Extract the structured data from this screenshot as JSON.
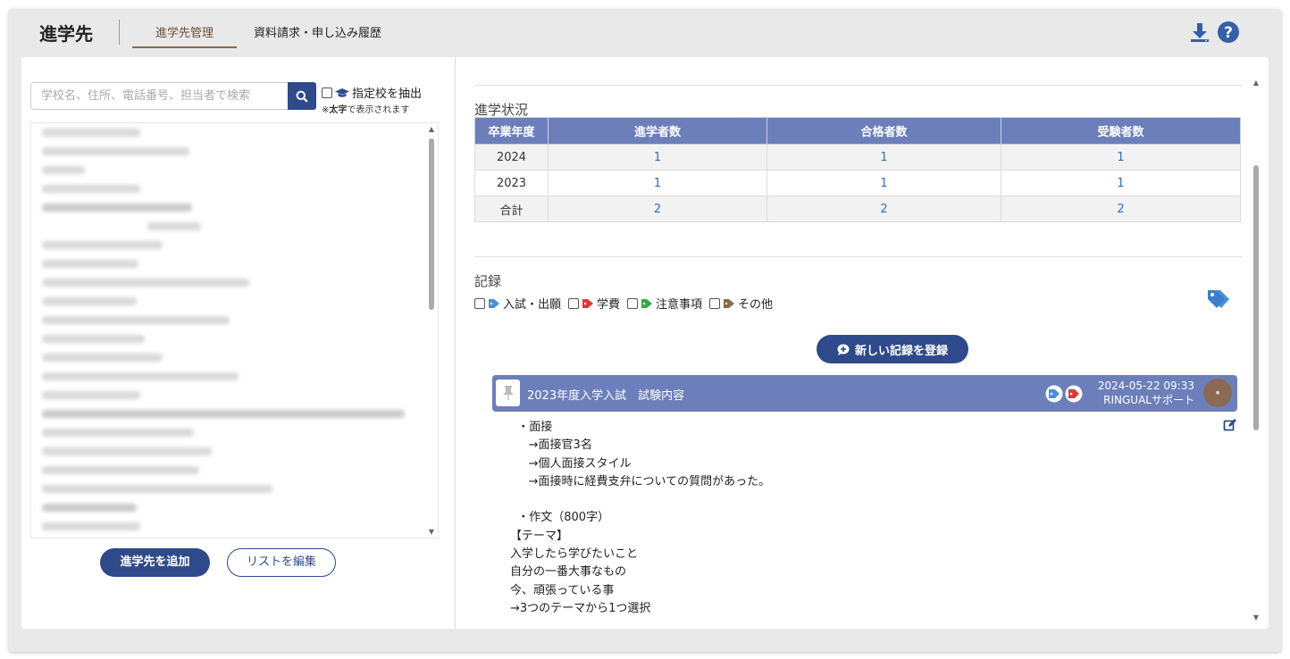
{
  "header": {
    "title": "進学先",
    "tabs": [
      {
        "label": "進学先管理"
      },
      {
        "label": "資料請求・申し込み履歴"
      }
    ],
    "icons": [
      "download-icon",
      "help-icon"
    ]
  },
  "sidebar": {
    "search_placeholder": "学校名、住所、電話番号、担当者で検索",
    "filter_label": "指定校を抽出",
    "filter_note_prefix": "※",
    "filter_note_bold": "太字",
    "filter_note_suffix": "で表示されます",
    "add_button": "進学先を追加",
    "edit_list_button": "リストを編集"
  },
  "status": {
    "title": "進学状況",
    "columns": [
      "卒業年度",
      "進学者数",
      "合格者数",
      "受験者数"
    ],
    "rows": [
      [
        "2024",
        "1",
        "1",
        "1"
      ],
      [
        "2023",
        "1",
        "1",
        "1"
      ],
      [
        "合計",
        "2",
        "2",
        "2"
      ]
    ]
  },
  "records": {
    "title": "記録",
    "tag_filters": [
      {
        "label": "入試・出願",
        "color": "#4a90d9"
      },
      {
        "label": "学費",
        "color": "#d83a3a"
      },
      {
        "label": "注意事項",
        "color": "#3aa84a"
      },
      {
        "label": "その他",
        "color": "#8a6a4a"
      }
    ],
    "new_button": "新しい記録を登録",
    "entry": {
      "title": "2023年度入学入試　試験内容",
      "date": "2024-05-22 09:33",
      "author": "RINGUALサポート",
      "body": "  ・面接\n     →面接官3名\n     →個人面接スタイル\n     →面接時に経費支弁についての質問があった。\n\n  ・作文（800字）\n【テーマ】\n入学したら学びたいこと\n自分の一番大事なもの\n今、頑張っている事\n→3つのテーマから1つ選択"
    }
  },
  "colors": {
    "primary": "#2f4a8a",
    "table_header": "#6c7fba",
    "tab_accent": "#8a6d46"
  }
}
